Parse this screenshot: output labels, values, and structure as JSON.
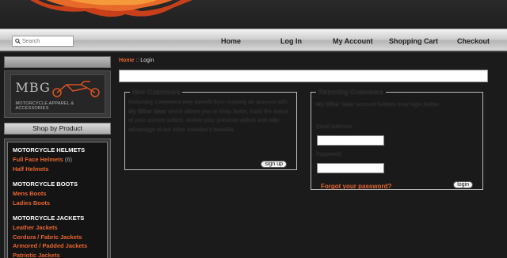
{
  "header": {
    "search_placeholder": "Search",
    "nav": [
      "Home",
      "Log In",
      "My Account",
      "Shopping Cart",
      "Checkout"
    ]
  },
  "sidebar": {
    "logo_text": "MBG",
    "logo_tagline": "MOTORCYCLE APPAREL & ACCESSORIES",
    "shop_heading": "Shop by Product",
    "categories": {
      "helmets": {
        "heading": "MOTORCYCLE HELMETS",
        "items": [
          "Full Face Helmets",
          "Half Helmets"
        ],
        "count": "(6)"
      },
      "boots": {
        "heading": "MOTORCYCLE BOOTS",
        "items": [
          "Mens Boots",
          "Ladies Boots"
        ]
      },
      "jackets": {
        "heading": "MOTORCYCLE JACKETS",
        "items": [
          "Leather Jackets",
          "Cordura / Fabric Jackets",
          "Armored / Padded Jackets",
          "Patriotic Jackets"
        ]
      }
    }
  },
  "breadcrumb": {
    "home": "Home",
    "separator": " :: ",
    "current": "Login"
  },
  "new_customers": {
    "legend": "New Customers",
    "text_before": "Returning customers may benefit from creating an account with ",
    "brand": "My Biker Gear",
    "text_after": " which allows you to shop faster, track the status of your current orders, review your previous orders and take advantage of our other member's benefits.",
    "signup_label": "sign up"
  },
  "returning_customers": {
    "legend": "Returning Customers",
    "brand": "My Biker Gear",
    "text": " account holders may login below.",
    "email_label": "Email Address:",
    "password_label": "Password:",
    "forgot_label": "Forgot your password?",
    "login_label": "login"
  },
  "colors": {
    "accent": "#e8652f",
    "background": "#1b1b1b"
  }
}
